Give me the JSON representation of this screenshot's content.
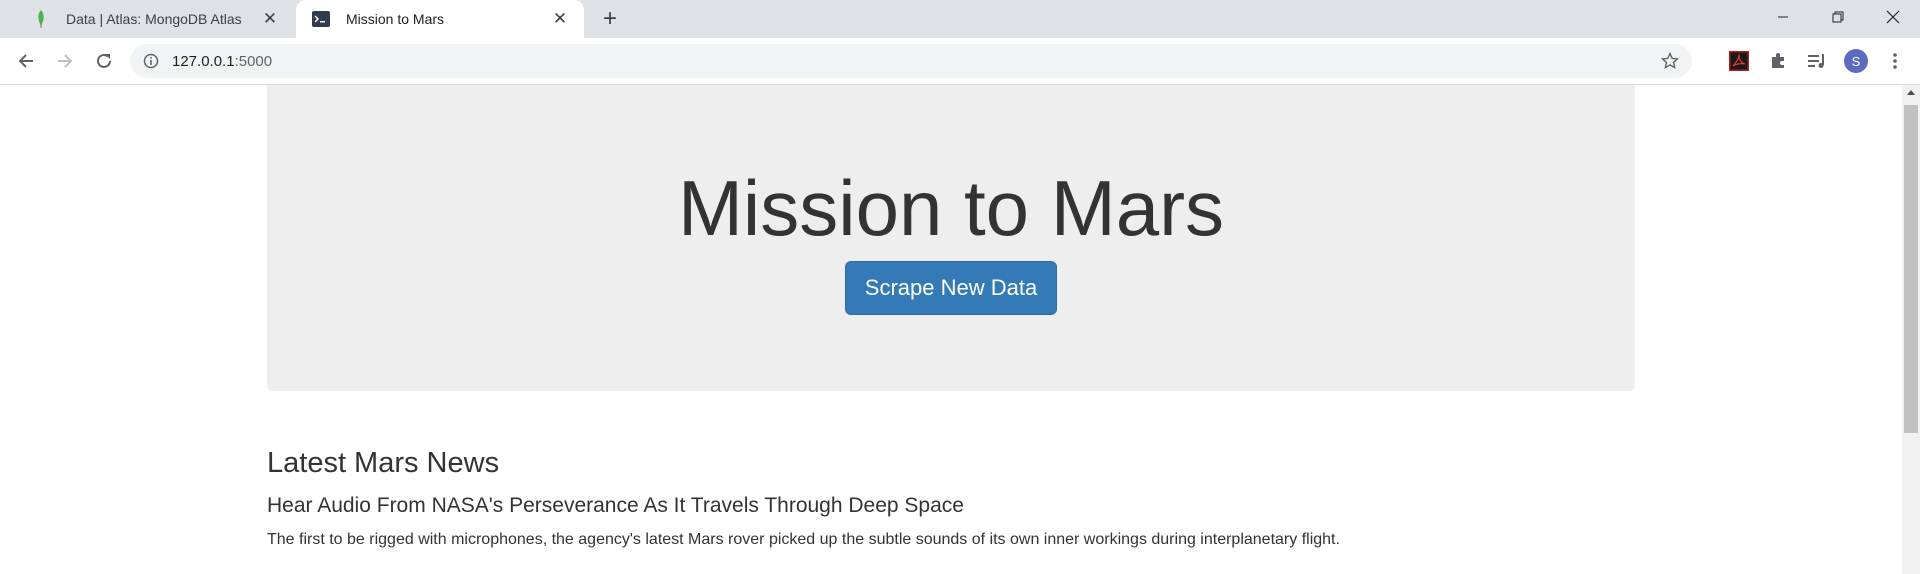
{
  "browser": {
    "tabs": [
      {
        "title": "Data | Atlas: MongoDB Atlas",
        "favicon": "mongodb-leaf-icon",
        "active": false
      },
      {
        "title": "Mission to Mars",
        "favicon": "terminal-icon",
        "active": true
      }
    ],
    "url_host": "127.0.0.1",
    "url_port": ":5000",
    "profile_initial": "S",
    "accent_color": "#337ab7"
  },
  "page": {
    "jumbotron": {
      "title": "Mission to Mars",
      "button_label": "Scrape New Data"
    },
    "news": {
      "heading": "Latest Mars News",
      "title": "Hear Audio From NASA's Perseverance As It Travels Through Deep Space",
      "paragraph": "The first to be rigged with microphones, the agency's latest Mars rover picked up the subtle sounds of its own inner workings during interplanetary flight."
    }
  }
}
